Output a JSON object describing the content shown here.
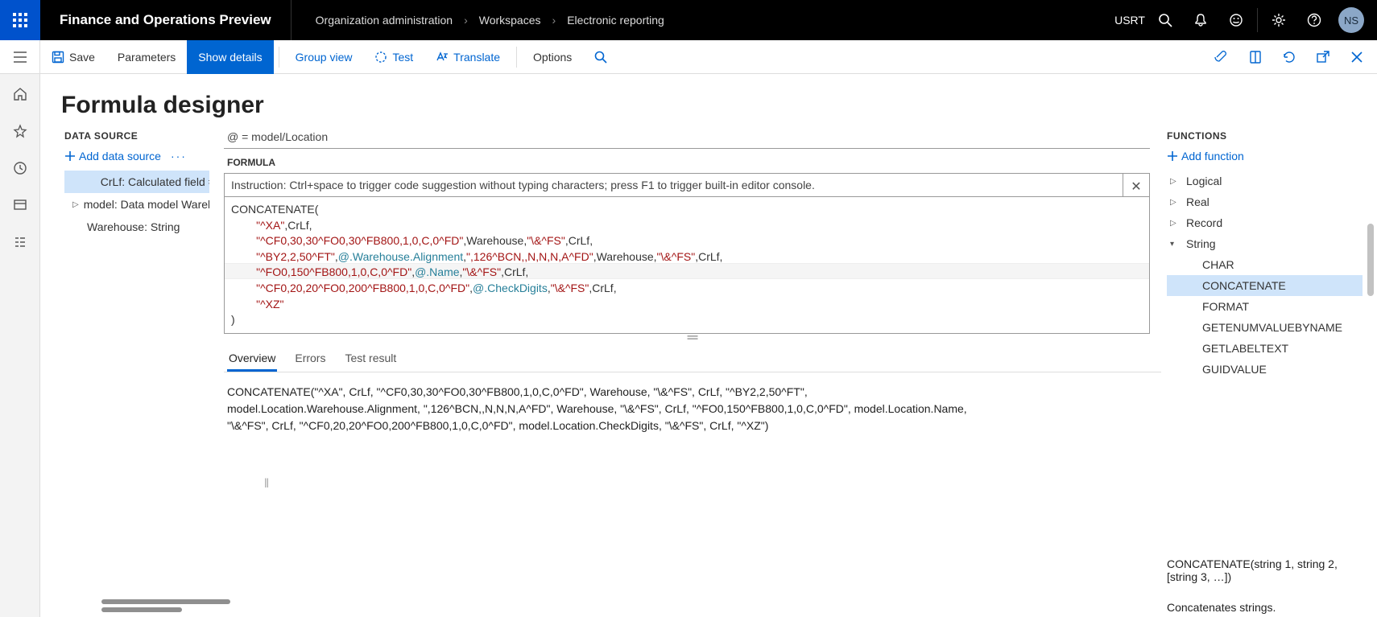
{
  "topbar": {
    "title": "Finance and Operations Preview",
    "breadcrumbs": [
      "Organization administration",
      "Workspaces",
      "Electronic reporting"
    ],
    "company": "USRT",
    "user_initials": "NS"
  },
  "actionbar": {
    "save": "Save",
    "parameters": "Parameters",
    "show_details": "Show details",
    "group_view": "Group view",
    "test": "Test",
    "translate": "Translate",
    "options": "Options"
  },
  "page": {
    "title": "Formula designer"
  },
  "data_source": {
    "header": "DATA SOURCE",
    "add_label": "Add data source",
    "nodes": [
      {
        "label": "CrLf: Calculated field = CH",
        "selected": true,
        "expand": "none"
      },
      {
        "label": "model: Data model Warel",
        "selected": false,
        "expand": "collapsed"
      },
      {
        "label": "Warehouse: String",
        "selected": false,
        "expand": "none"
      }
    ]
  },
  "formula": {
    "at_line": "@ = model/Location",
    "label": "FORMULA",
    "instruction": "Instruction: Ctrl+space to trigger code suggestion without typing characters; press F1 to trigger built-in editor console.",
    "code_lines": [
      {
        "indent": 0,
        "parts": [
          {
            "t": "fn",
            "v": "CONCATENATE("
          }
        ]
      },
      {
        "indent": 2,
        "parts": [
          {
            "t": "str",
            "v": "\"^XA\""
          },
          {
            "t": "fn",
            "v": ","
          },
          {
            "t": "ident",
            "v": "CrLf"
          },
          {
            "t": "fn",
            "v": ","
          }
        ]
      },
      {
        "indent": 2,
        "parts": [
          {
            "t": "str",
            "v": "\"^CF0,30,30^FO0,30^FB800,1,0,C,0^FD\""
          },
          {
            "t": "fn",
            "v": ","
          },
          {
            "t": "ident",
            "v": "Warehouse"
          },
          {
            "t": "fn",
            "v": ","
          },
          {
            "t": "str",
            "v": "\"\\&^FS\""
          },
          {
            "t": "fn",
            "v": ","
          },
          {
            "t": "ident",
            "v": "CrLf"
          },
          {
            "t": "fn",
            "v": ","
          }
        ]
      },
      {
        "indent": 2,
        "parts": [
          {
            "t": "str",
            "v": "\"^BY2,2,50^FT\""
          },
          {
            "t": "fn",
            "v": ","
          },
          {
            "t": "at",
            "v": "@.Warehouse.Alignment"
          },
          {
            "t": "fn",
            "v": ","
          },
          {
            "t": "str",
            "v": "\",126^BCN,,N,N,N,A^FD\""
          },
          {
            "t": "fn",
            "v": ","
          },
          {
            "t": "ident",
            "v": "Warehouse"
          },
          {
            "t": "fn",
            "v": ","
          },
          {
            "t": "str",
            "v": "\"\\&^FS\""
          },
          {
            "t": "fn",
            "v": ","
          },
          {
            "t": "ident",
            "v": "CrLf"
          },
          {
            "t": "fn",
            "v": ","
          }
        ]
      },
      {
        "indent": 2,
        "parts": [
          {
            "t": "str",
            "v": "\"^FO0,150^FB800,1,0,C,0^FD\""
          },
          {
            "t": "fn",
            "v": ","
          },
          {
            "t": "at",
            "v": "@.Name"
          },
          {
            "t": "fn",
            "v": ","
          },
          {
            "t": "str",
            "v": "\"\\&^FS\""
          },
          {
            "t": "fn",
            "v": ","
          },
          {
            "t": "ident",
            "v": "CrLf"
          },
          {
            "t": "fn",
            "v": ","
          }
        ]
      },
      {
        "indent": 2,
        "parts": [
          {
            "t": "str",
            "v": "\"^CF0,20,20^FO0,200^FB800,1,0,C,0^FD\""
          },
          {
            "t": "fn",
            "v": ","
          },
          {
            "t": "at",
            "v": "@.CheckDigits"
          },
          {
            "t": "fn",
            "v": ","
          },
          {
            "t": "str",
            "v": "\"\\&^FS\""
          },
          {
            "t": "fn",
            "v": ","
          },
          {
            "t": "ident",
            "v": "CrLf"
          },
          {
            "t": "fn",
            "v": ","
          }
        ]
      },
      {
        "indent": 2,
        "parts": [
          {
            "t": "str",
            "v": "\"^XZ\""
          }
        ]
      },
      {
        "indent": 0,
        "parts": [
          {
            "t": "fn",
            "v": ")"
          }
        ]
      }
    ]
  },
  "tabs": {
    "items": [
      "Overview",
      "Errors",
      "Test result"
    ],
    "selected": 0,
    "overview_text": "CONCATENATE(\"^XA\", CrLf, \"^CF0,30,30^FO0,30^FB800,1,0,C,0^FD\", Warehouse, \"\\&^FS\", CrLf, \"^BY2,2,50^FT\", model.Location.Warehouse.Alignment, \",126^BCN,,N,N,N,A^FD\", Warehouse, \"\\&^FS\", CrLf, \"^FO0,150^FB800,1,0,C,0^FD\", model.Location.Name, \"\\&^FS\", CrLf, \"^CF0,20,20^FO0,200^FB800,1,0,C,0^FD\", model.Location.CheckDigits, \"\\&^FS\", CrLf, \"^XZ\")"
  },
  "functions": {
    "header": "FUNCTIONS",
    "add_label": "Add function",
    "groups": [
      {
        "name": "Logical",
        "expanded": false,
        "items": []
      },
      {
        "name": "Real",
        "expanded": false,
        "items": []
      },
      {
        "name": "Record",
        "expanded": false,
        "items": []
      },
      {
        "name": "String",
        "expanded": true,
        "items": [
          "CHAR",
          "CONCATENATE",
          "FORMAT",
          "GETENUMVALUEBYNAME",
          "GETLABELTEXT",
          "GUIDVALUE"
        ]
      }
    ],
    "selected_item": "CONCATENATE",
    "signature": "CONCATENATE(string 1, string 2, [string 3, …])",
    "description": "Concatenates strings."
  }
}
